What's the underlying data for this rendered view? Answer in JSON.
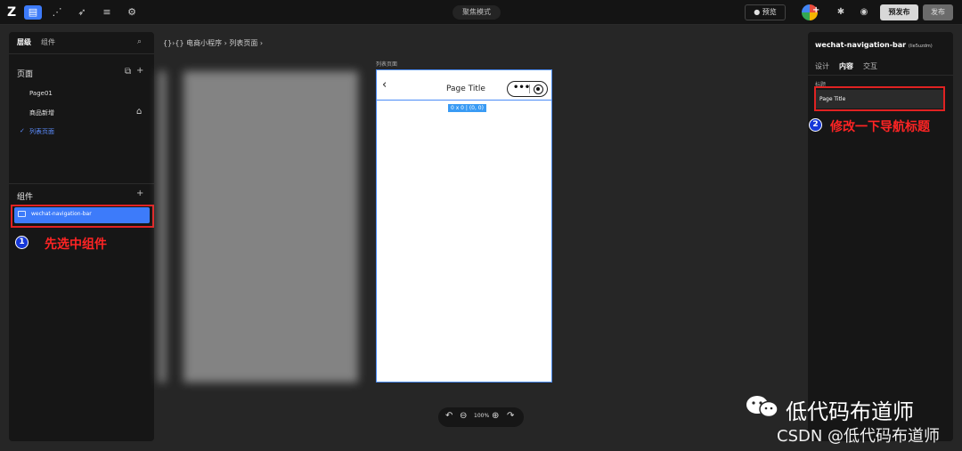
{
  "topbar": {
    "logo": "Z",
    "mode_label": "聚焦模式",
    "preview_label": "预览",
    "pre_publish_label": "预发布",
    "publish_label": "发布"
  },
  "left_panel": {
    "tabs": [
      "层级",
      "组件"
    ],
    "pages_heading": "页面",
    "pages": [
      "Page01",
      "商品新增",
      "列表页面"
    ],
    "components_heading": "组件",
    "selected_component": "wechat-navigation-bar"
  },
  "breadcrumb": "{}›{} 电商小程序 › 列表页面 ›",
  "canvas": {
    "page_label": "列表页面",
    "nav_title": "Page Title",
    "size_badge": "0 x 0 | (0, 0)",
    "zoom_value": "100%"
  },
  "right_panel": {
    "component_name": "wechat-navigation-bar",
    "component_id": "(lie5uzdm)",
    "tabs": [
      "设计",
      "内容",
      "交互"
    ],
    "field_label": "标题",
    "field_value": "Page Title"
  },
  "annotations": [
    {
      "number": "1",
      "text": "先选中组件"
    },
    {
      "number": "2",
      "text": "修改一下导航标题"
    }
  ],
  "watermark": {
    "brand": "低代码布道师",
    "csdn": "CSDN @低代码布道师"
  },
  "colors": {
    "accent": "#3d7bfa",
    "highlight": "#e02222",
    "annotation_text": "#ff2424"
  }
}
